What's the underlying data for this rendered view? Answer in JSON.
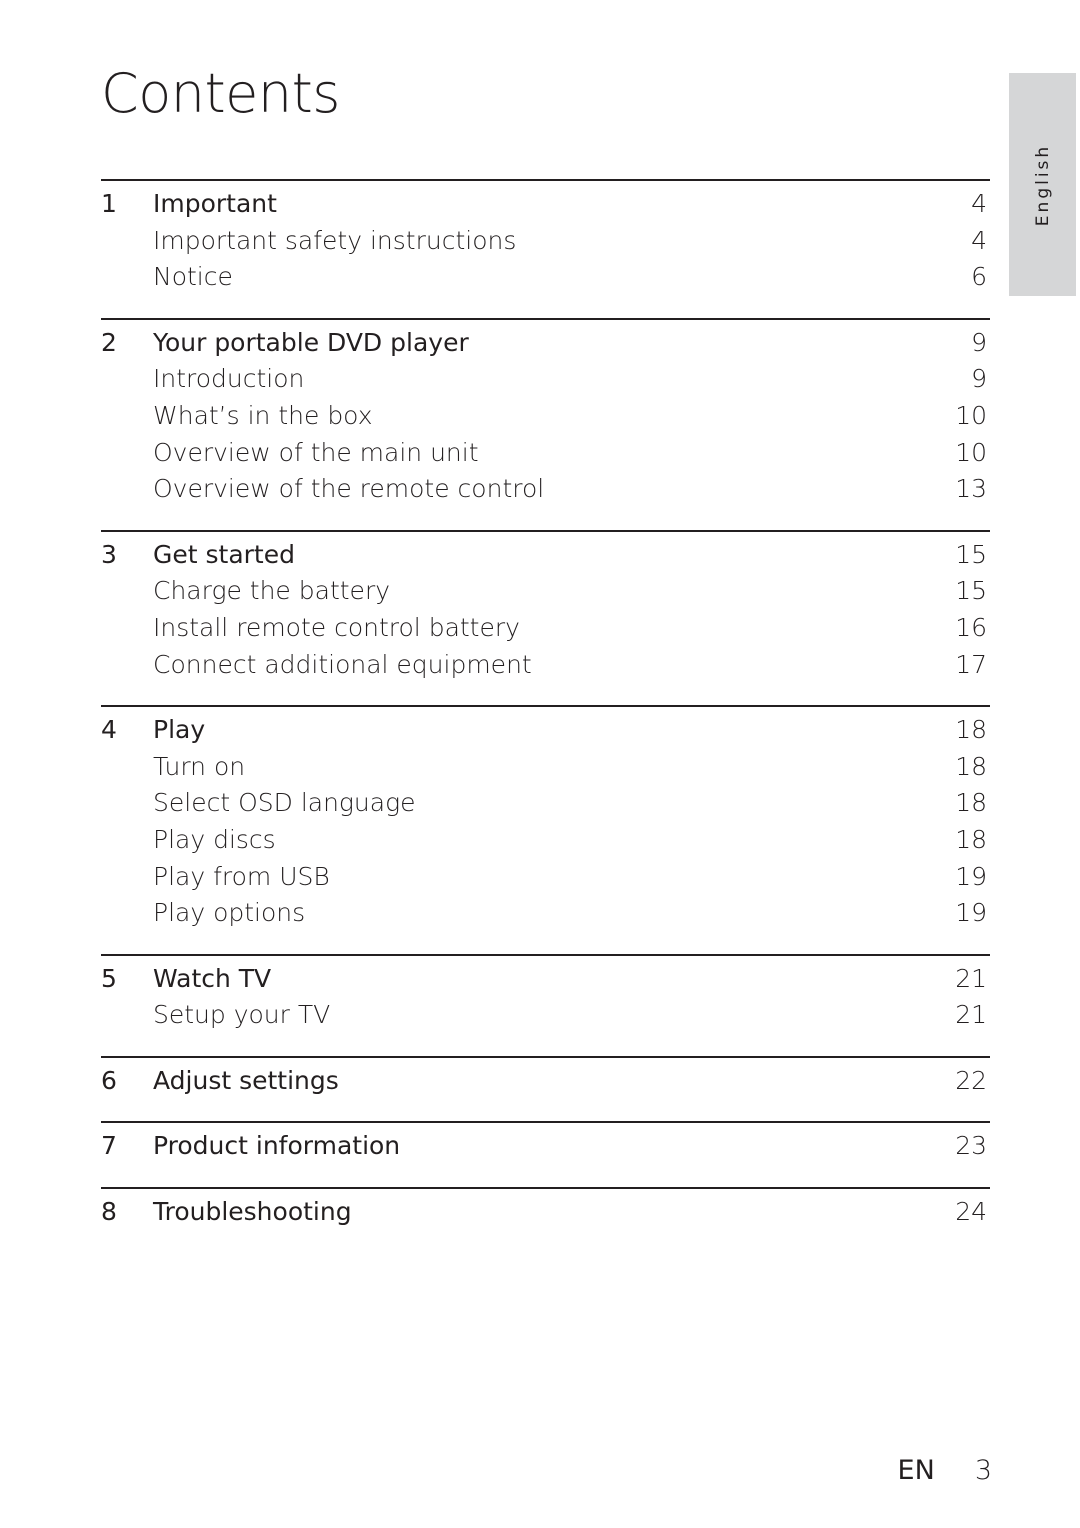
{
  "page_title": "Contents",
  "language_tab": "English",
  "sections": [
    {
      "number": "1",
      "title": "Important",
      "page": "4",
      "items": [
        {
          "label": "Important safety instructions",
          "page": "4"
        },
        {
          "label": "Notice",
          "page": "6"
        }
      ]
    },
    {
      "number": "2",
      "title": "Your portable DVD player",
      "page": "9",
      "items": [
        {
          "label": "Introduction",
          "page": "9"
        },
        {
          "label": "What’s in the box",
          "page": "10"
        },
        {
          "label": "Overview of the main unit",
          "page": "10"
        },
        {
          "label": "Overview of the remote control",
          "page": "13"
        }
      ]
    },
    {
      "number": "3",
      "title": "Get started",
      "page": "15",
      "items": [
        {
          "label": "Charge the battery",
          "page": "15"
        },
        {
          "label": "Install remote control battery",
          "page": "16"
        },
        {
          "label": "Connect additional equipment",
          "page": "17"
        }
      ]
    },
    {
      "number": "4",
      "title": "Play",
      "page": "18",
      "items": [
        {
          "label": "Turn on",
          "page": "18"
        },
        {
          "label": "Select OSD language",
          "page": "18"
        },
        {
          "label": "Play discs",
          "page": "18"
        },
        {
          "label": "Play from USB",
          "page": "19"
        },
        {
          "label": "Play options",
          "page": "19"
        }
      ]
    },
    {
      "number": "5",
      "title": "Watch TV",
      "page": "21",
      "items": [
        {
          "label": "Setup your TV",
          "page": "21"
        }
      ]
    },
    {
      "number": "6",
      "title": "Adjust settings",
      "page": "22",
      "items": []
    },
    {
      "number": "7",
      "title": "Product information",
      "page": "23",
      "items": []
    },
    {
      "number": "8",
      "title": "Troubleshooting",
      "page": "24",
      "items": []
    }
  ],
  "footer": {
    "language_code": "EN",
    "page_number": "3"
  }
}
